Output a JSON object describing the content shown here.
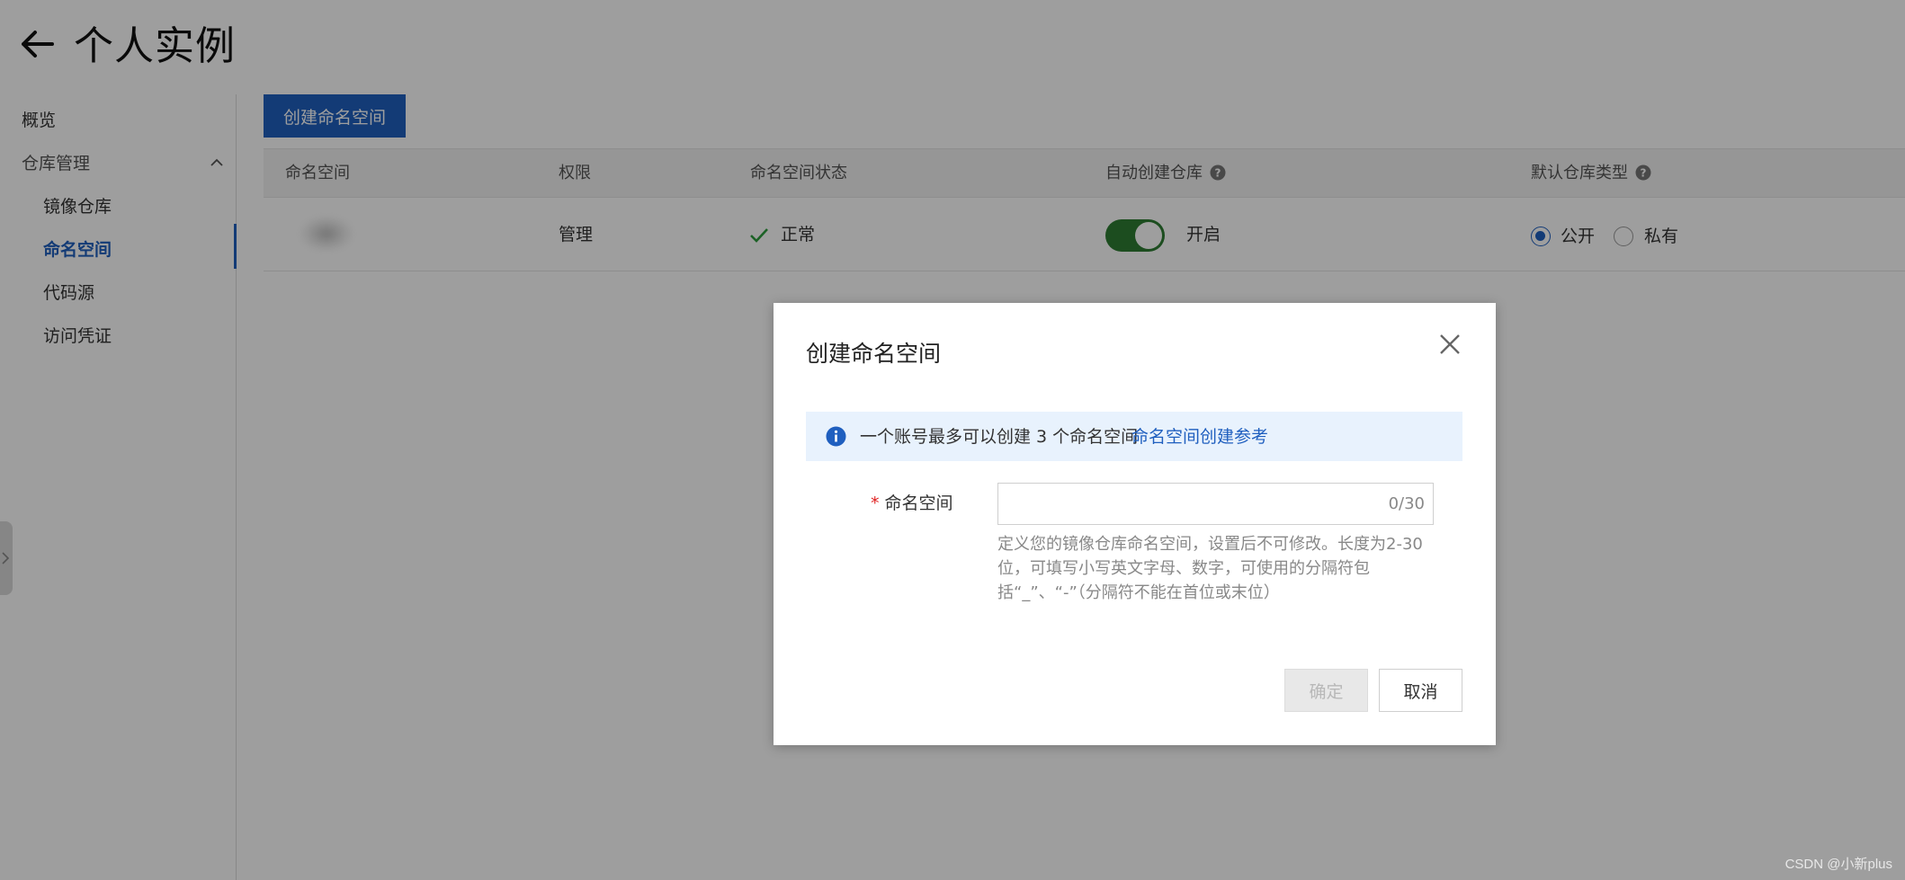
{
  "header": {
    "title": "个人实例",
    "back_icon": "arrow-left-icon"
  },
  "sidebar": {
    "overview": "概览",
    "group": "仓库管理",
    "items": [
      {
        "label": "镜像仓库"
      },
      {
        "label": "命名空间",
        "active": true
      },
      {
        "label": "代码源"
      },
      {
        "label": "访问凭证"
      }
    ]
  },
  "main": {
    "create_button": "创建命名空间",
    "columns": [
      "命名空间",
      "权限",
      "命名空间状态",
      "自动创建仓库",
      "默认仓库类型"
    ],
    "row": {
      "permission": "管理",
      "status": "正常",
      "auto_create": "开启",
      "auto_create_enabled": true,
      "repo_type_options": [
        "公开",
        "私有"
      ],
      "repo_type_selected": "公开"
    }
  },
  "modal": {
    "title": "创建命名空间",
    "info_text": "一个账号最多可以创建 3 个命名空间",
    "info_link": "命名空间创建参考",
    "field_label": "命名空间",
    "field_value": "",
    "field_counter": "0/30",
    "field_help": "定义您的镜像仓库命名空间，设置后不可修改。长度为2-30位，可填写小写英文字母、数字，可使用的分隔符包括“_”、“-”（分隔符不能在首位或末位）",
    "ok_label": "确定",
    "cancel_label": "取消"
  },
  "watermark": "CSDN @小新plus",
  "colors": {
    "accent": "#1f5fbf",
    "toggle_on": "#2e7d32",
    "info_bg": "#e8f2fd"
  }
}
